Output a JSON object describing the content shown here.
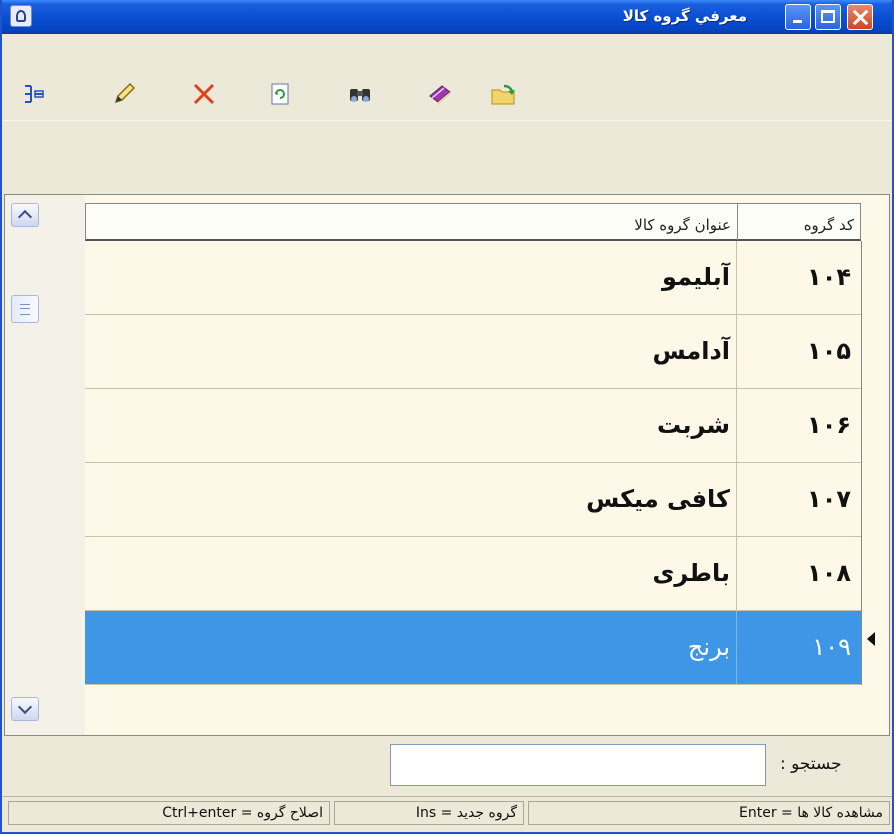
{
  "window": {
    "title": "معرفي گروه كالا"
  },
  "toolbar": {
    "tools": [
      {
        "icon": "tree-structure-icon"
      },
      {
        "icon": "pencil-edit-icon"
      },
      {
        "icon": "delete-x-icon"
      },
      {
        "icon": "refresh-icon"
      },
      {
        "icon": "binoculars-find-icon"
      },
      {
        "icon": "book-icon"
      },
      {
        "icon": "folder-export-icon"
      }
    ]
  },
  "grid": {
    "columns": {
      "code": "کد گروه",
      "name": "عنوان گروه کالا"
    },
    "rows": [
      {
        "code": "۱۰۴",
        "name": "آبلیمو"
      },
      {
        "code": "۱۰۵",
        "name": "آدامس"
      },
      {
        "code": "۱۰۶",
        "name": "شربت"
      },
      {
        "code": "۱۰۷",
        "name": "کافی میکس"
      },
      {
        "code": "۱۰۸",
        "name": "باطری"
      },
      {
        "code": "۱۰۹",
        "name": "برنج"
      }
    ],
    "selected_row_index": 5
  },
  "search": {
    "label": "جستجو :",
    "value": ""
  },
  "statusbar": {
    "view_items": "مشاهده کالا ها = Enter",
    "new_group": "گروه جدید = Ins",
    "edit_group": "اصلاح گروه = Ctrl+enter"
  },
  "colors": {
    "titlebar": "#0a4fd3",
    "selection": "#3d96e6",
    "grid_background": "#fdf8e8"
  }
}
